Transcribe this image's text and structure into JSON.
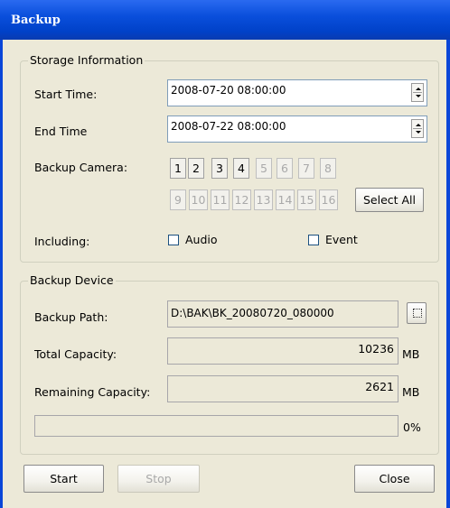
{
  "window": {
    "title": "Backup"
  },
  "storage": {
    "group_title": "Storage  Information",
    "start_time_label": "Start Time:",
    "start_time_value": "2008-07-20 08:00:00",
    "end_time_label": "End Time",
    "end_time_value": "2008-07-22 08:00:00",
    "camera_label": "Backup Camera:",
    "cameras_row1": [
      "1",
      "2",
      "3",
      "4",
      "5",
      "6",
      "7",
      "8"
    ],
    "cameras_row2": [
      "9",
      "10",
      "11",
      "12",
      "13",
      "14",
      "15",
      "16"
    ],
    "select_all_label": "Select All",
    "including_label": "Including:",
    "audio_label": "Audio",
    "event_label": "Event"
  },
  "device": {
    "group_title": "Backup Device",
    "path_label": "Backup Path:",
    "path_value": "D:\\BAK\\BK_20080720_080000",
    "total_label": "Total Capacity:",
    "total_value": "10236",
    "total_unit": "MB",
    "remaining_label": "Remaining Capacity:",
    "remaining_value": "2621",
    "remaining_unit": "MB",
    "progress_text": "0%",
    "progress_fraction": 0
  },
  "buttons": {
    "start": "Start",
    "stop": "Stop",
    "close": "Close"
  },
  "icons": {
    "spin": "spin-updown-icon",
    "browse": "browse-folder-icon"
  }
}
